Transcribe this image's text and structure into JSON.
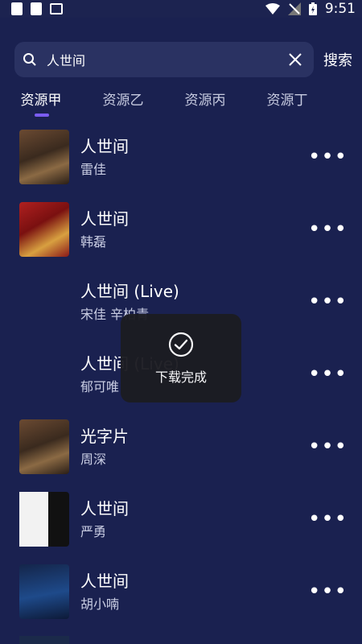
{
  "statusbar": {
    "time": "9:51"
  },
  "search": {
    "query": "人世间",
    "button": "搜索"
  },
  "tabs": [
    "资源甲",
    "资源乙",
    "资源丙",
    "资源丁"
  ],
  "songs": [
    {
      "title": "人世间",
      "artist": "雷佳",
      "cover": "c1"
    },
    {
      "title": "人世间",
      "artist": "韩磊",
      "cover": "c2"
    },
    {
      "title": "人世间 (Live)",
      "artist": "宋佳  辛柏青",
      "cover": "none"
    },
    {
      "title": "人世间 (Live)",
      "artist": "郁可唯",
      "cover": "none"
    },
    {
      "title": "光字片",
      "artist": "周深",
      "cover": "c1"
    },
    {
      "title": "人世间",
      "artist": "严勇",
      "cover": "c3"
    },
    {
      "title": "人世间",
      "artist": "胡小喃",
      "cover": "c4"
    }
  ],
  "toast": {
    "text": "下载完成",
    "icon": "check-circle-icon"
  },
  "colors": {
    "background": "#1a2150",
    "accent": "#7a5cf0"
  }
}
